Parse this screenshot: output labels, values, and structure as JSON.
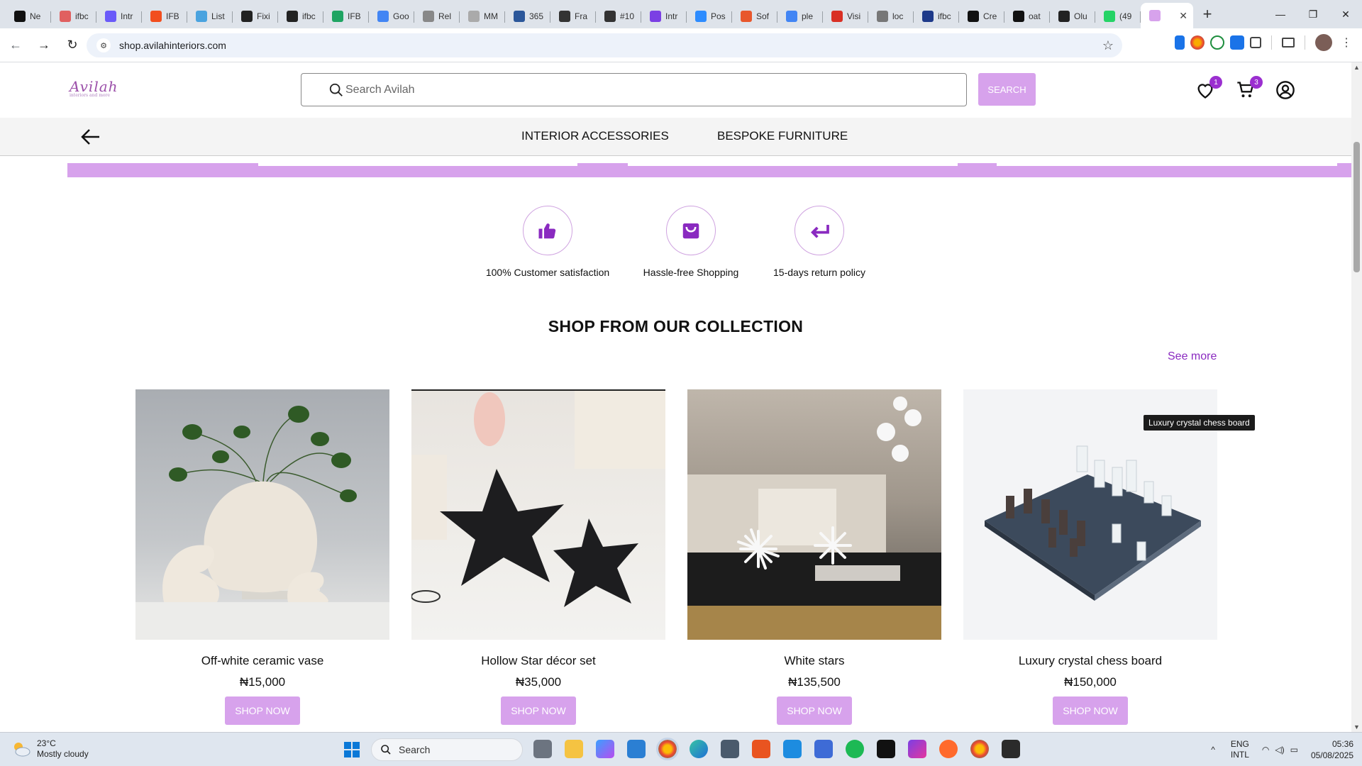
{
  "browser": {
    "tabs": [
      {
        "title": "Ne",
        "color": "#111111"
      },
      {
        "title": "ifbc",
        "color": "#e06060"
      },
      {
        "title": "Intr",
        "color": "#6a5af9"
      },
      {
        "title": "IFB",
        "color": "#f24e1e"
      },
      {
        "title": "List",
        "color": "#4aa3df"
      },
      {
        "title": "Fixi",
        "color": "#222222"
      },
      {
        "title": "ifbc",
        "color": "#222222"
      },
      {
        "title": "IFB",
        "color": "#1fa463"
      },
      {
        "title": "Goo",
        "color": "#4285f4"
      },
      {
        "title": "Rel",
        "color": "#888888"
      },
      {
        "title": "MM",
        "color": "#aaaaaa"
      },
      {
        "title": "365",
        "color": "#2b579a"
      },
      {
        "title": "Fra",
        "color": "#333333"
      },
      {
        "title": "#10",
        "color": "#333333"
      },
      {
        "title": "Intr",
        "color": "#7b3fe4"
      },
      {
        "title": "Pos",
        "color": "#2d8cff"
      },
      {
        "title": "Sof",
        "color": "#e8572c"
      },
      {
        "title": "ple",
        "color": "#4285f4"
      },
      {
        "title": "Visi",
        "color": "#d93025"
      },
      {
        "title": "loc",
        "color": "#777777"
      },
      {
        "title": "ifbc",
        "color": "#1e3a8a"
      },
      {
        "title": "Cre",
        "color": "#111111"
      },
      {
        "title": "oat",
        "color": "#111111"
      },
      {
        "title": "Olu",
        "color": "#222222"
      },
      {
        "title": "(49",
        "color": "#25d366"
      }
    ],
    "active_tab_color": "#d7a2ec",
    "url": "shop.avilahinteriors.com"
  },
  "site": {
    "logo_text": "Avilah",
    "logo_tagline": "interiors and more",
    "search_placeholder": "Search Avilah",
    "search_button": "SEARCH",
    "wishlist_count": "1",
    "cart_count": "3",
    "nav": {
      "interior_accessories": "INTERIOR ACCESSORIES",
      "bespoke_furniture": "BESPOKE FURNITURE"
    },
    "features": [
      {
        "label": "100% Customer satisfaction",
        "icon": "thumbs-up-icon"
      },
      {
        "label": "Hassle-free Shopping",
        "icon": "shopping-bag-icon"
      },
      {
        "label": "15-days return policy",
        "icon": "return-arrow-icon"
      }
    ],
    "section_title": "SHOP FROM OUR COLLECTION",
    "see_more": "See more",
    "products": [
      {
        "name": "Off-white ceramic vase",
        "price": "₦15,000",
        "button": "SHOP NOW"
      },
      {
        "name": "Hollow Star décor set",
        "price": "₦35,000",
        "button": "SHOP NOW"
      },
      {
        "name": "White stars",
        "price": "₦135,500",
        "button": "SHOP NOW"
      },
      {
        "name": "Luxury crystal chess board",
        "price": "₦150,000",
        "button": "SHOP NOW"
      }
    ],
    "tooltip": "Luxury crystal chess board",
    "accent_color": "#d7a2ec",
    "link_color": "#8a2ac0"
  },
  "taskbar": {
    "temperature": "23°C",
    "weather": "Mostly cloudy",
    "search_label": "Search",
    "language": "ENG",
    "layout": "INTL",
    "time": "05:36",
    "date": "05/08/2025"
  }
}
